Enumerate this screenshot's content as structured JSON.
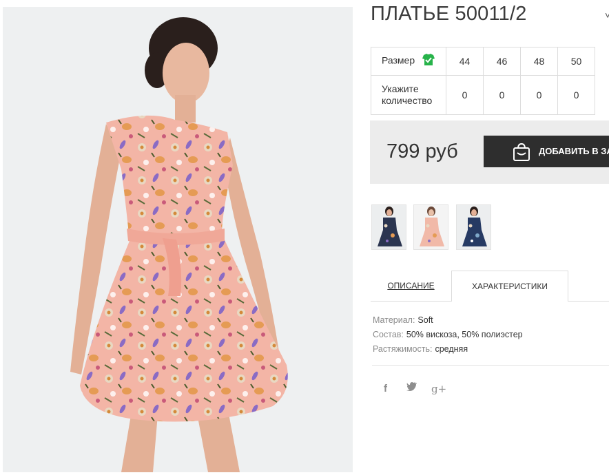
{
  "product": {
    "title": "ПЛАТЬЕ 50011/2",
    "title_extra": "˅"
  },
  "sizes": {
    "size_label": "Размер",
    "qty_label": "Укажите количество",
    "sizes": [
      "44",
      "46",
      "48",
      "50"
    ],
    "quantities": [
      "0",
      "0",
      "0",
      "0"
    ]
  },
  "purchase": {
    "price": "799 руб",
    "add_to_cart": "ДОБАВИТЬ В ЗАКАЗ"
  },
  "tabs": {
    "description": "ОПИСАНИЕ",
    "characteristics": "ХАРАКТЕРИСТИКИ"
  },
  "characteristics": [
    {
      "key": "Материал:",
      "value": "Soft"
    },
    {
      "key": "Состав:",
      "value": "50% вискоза, 50% полиэстер"
    },
    {
      "key": "Растяжимость:",
      "value": "средняя"
    }
  ],
  "social": {
    "facebook": "f",
    "twitter": "🐦",
    "google_plus": "g+"
  },
  "thumbnails": [
    {
      "name": "navy-floral",
      "color": "#2b3550"
    },
    {
      "name": "peach-floral",
      "color": "#f1b9a8"
    },
    {
      "name": "blue-floral",
      "color": "#263a63"
    }
  ],
  "colors": {
    "accent_dark": "#2e2e2e",
    "price_bg": "#ececec",
    "tick_green": "#27b34a",
    "dress_peach": "#f3b5a6"
  }
}
